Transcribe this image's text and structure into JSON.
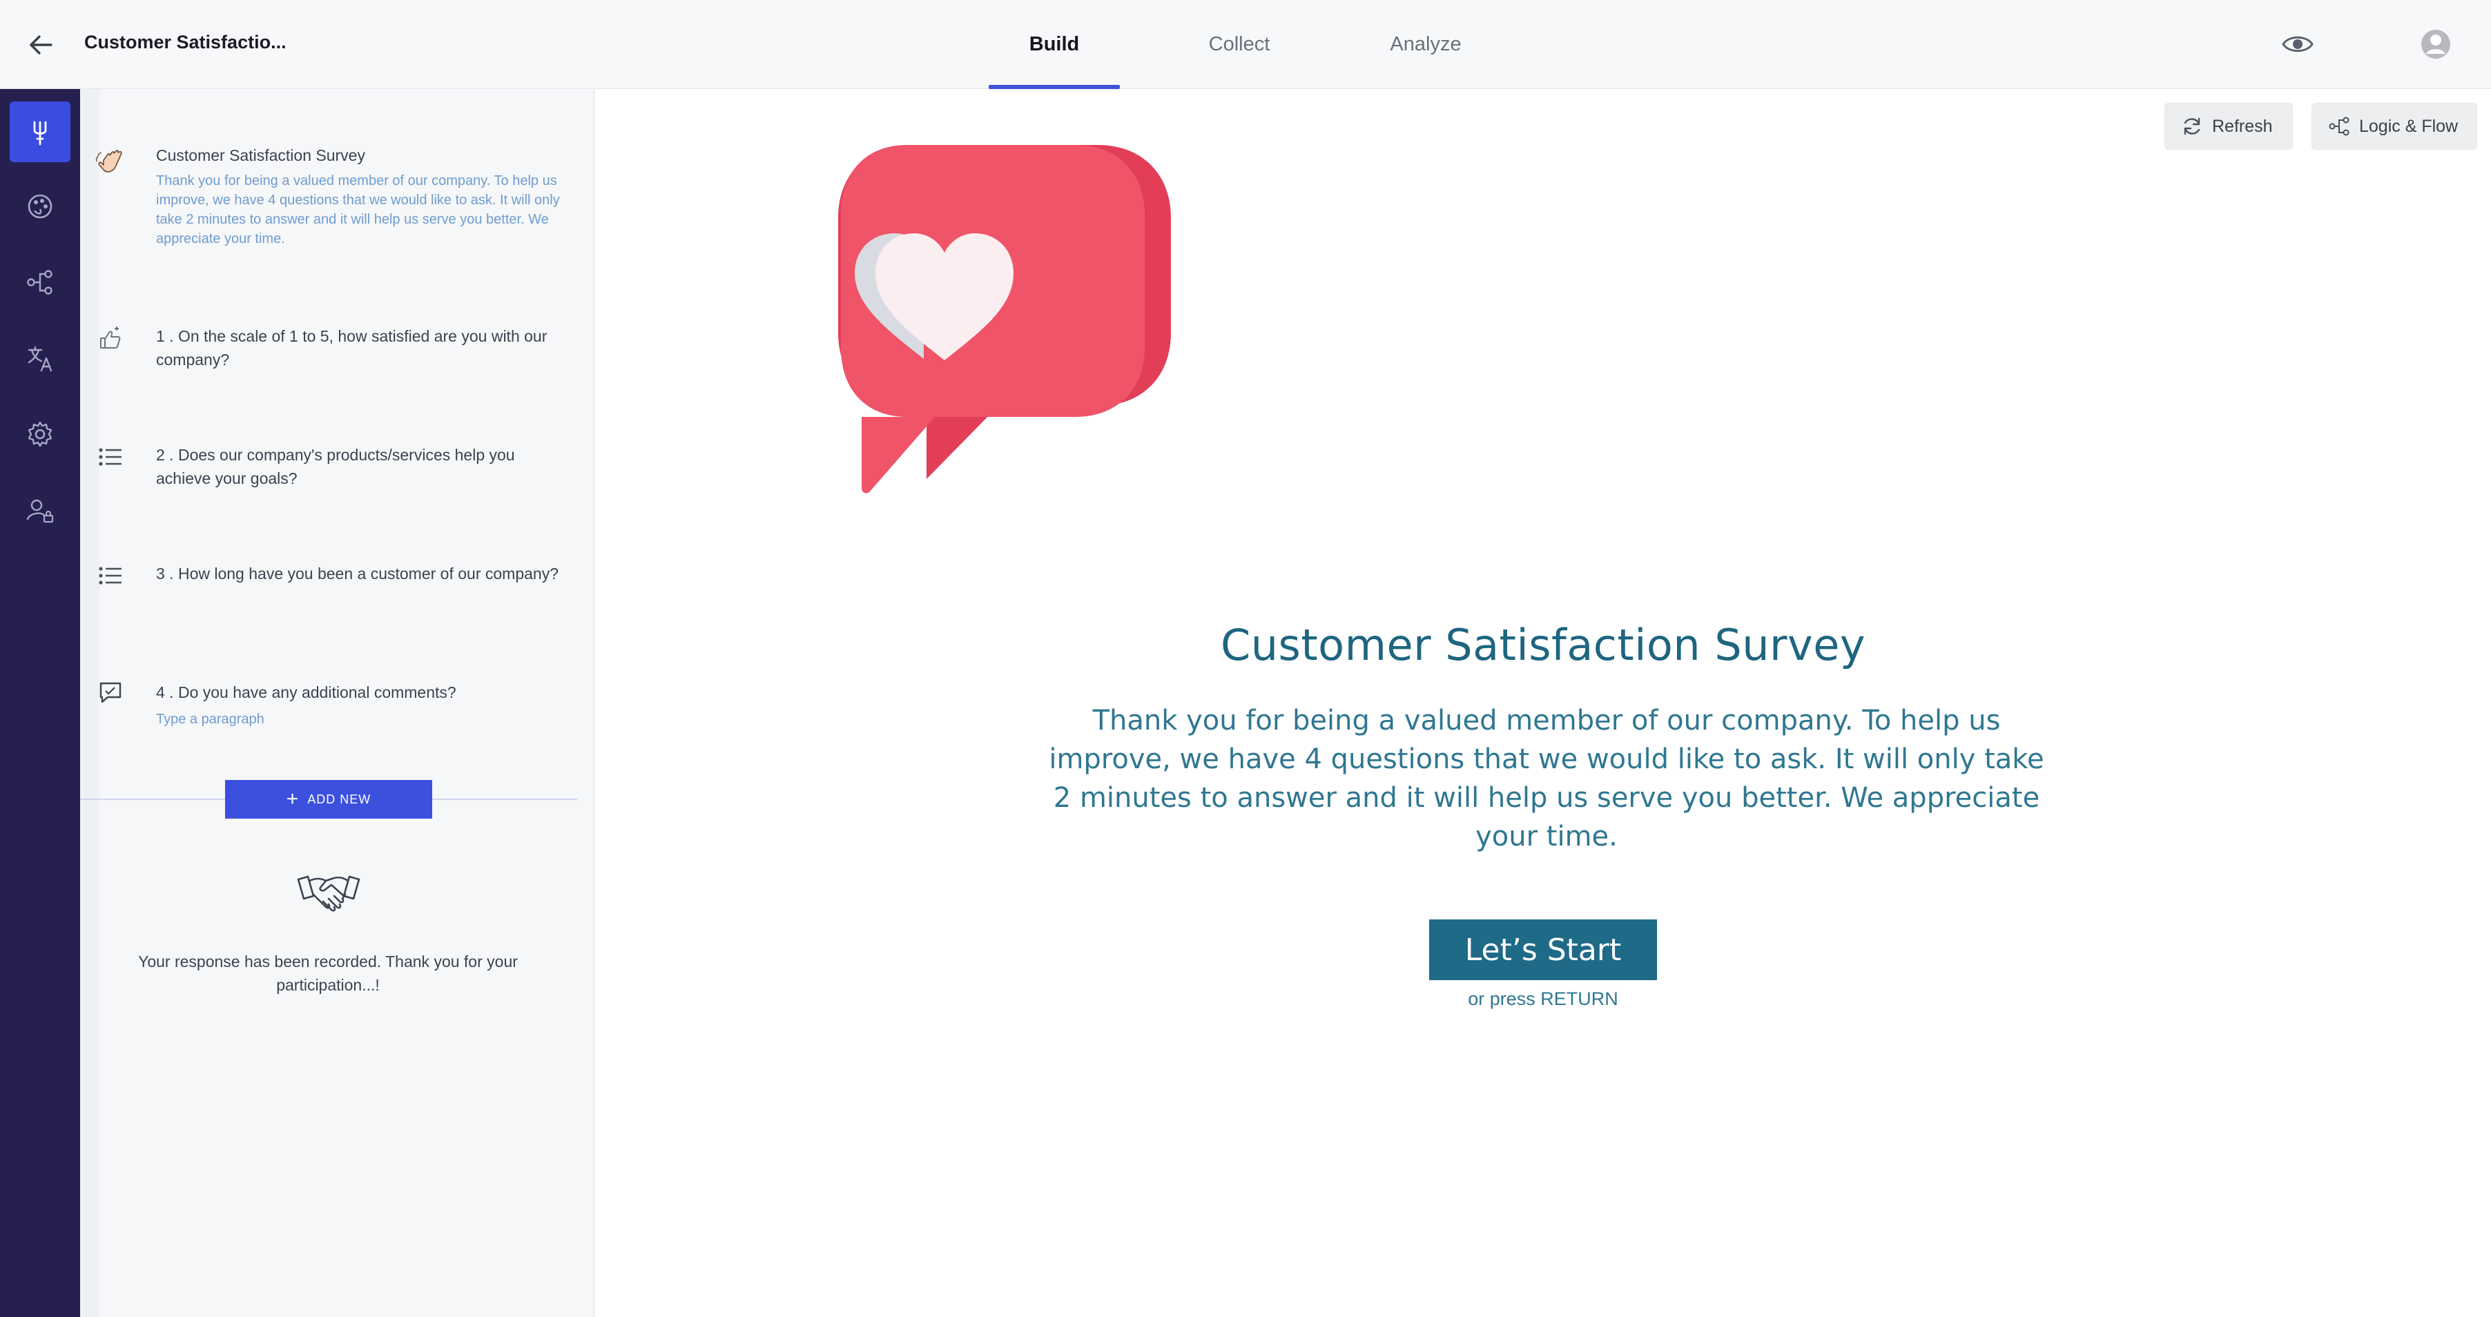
{
  "header": {
    "title": "Customer Satisfactio...",
    "tabs": [
      {
        "label": "Build",
        "active": true
      },
      {
        "label": "Collect",
        "active": false
      },
      {
        "label": "Analyze",
        "active": false
      }
    ],
    "icons": [
      "back-arrow-icon",
      "eye-icon",
      "user-avatar-icon"
    ]
  },
  "rail": {
    "items": [
      {
        "icon": "fork-build-icon",
        "active": true
      },
      {
        "icon": "palette-icon",
        "active": false
      },
      {
        "icon": "flow-icon",
        "active": false
      },
      {
        "icon": "translate-icon",
        "active": false
      },
      {
        "icon": "gear-icon",
        "active": false
      },
      {
        "icon": "user-lock-icon",
        "active": false
      }
    ]
  },
  "panel": {
    "welcome": {
      "icon": "waving-hand-icon",
      "title": "Customer Satisfaction Survey",
      "description": "Thank you for being a valued member of our company. To help us improve, we have 4 questions that we would like to ask. It will only take 2 minutes to answer and it will help us serve you better. We appreciate your time."
    },
    "questions": [
      {
        "icon": "thumbs-rating-icon",
        "text": "1 . On the scale of 1 to 5, how satisfied are you with our company?"
      },
      {
        "icon": "list-icon",
        "text": "2 . Does our company's products/services help you achieve your goals?"
      },
      {
        "icon": "list-icon",
        "text": "3 . How long have you been a customer of our company?"
      },
      {
        "icon": "comment-icon",
        "text": "4 . Do you have any additional comments?",
        "placeholder": "Type a paragraph"
      }
    ],
    "add_new_label": "ADD NEW",
    "thank_you": {
      "icon": "handshake-icon",
      "text": "Your response has been recorded. Thank you for your participation...!"
    }
  },
  "main": {
    "toolbar": {
      "refresh_label": "Refresh",
      "logic_label": "Logic & Flow"
    },
    "hero_icon": "heart-speech-bubble-icon",
    "survey_title": "Customer Satisfaction Survey",
    "survey_description": "Thank you for being a valued member of our company. To help us improve, we have 4 questions that we would like to ask. It will only take 2 minutes to answer and it will help us serve you better. We appreciate your time.",
    "start_label": "Let’s Start",
    "press_hint": "or press RETURN"
  },
  "colors": {
    "accent": "#3c50de",
    "rail": "#25204f",
    "survey_text": "#1e6580",
    "start_button": "#1e6a87",
    "heart_bubble": "#ef5468"
  }
}
